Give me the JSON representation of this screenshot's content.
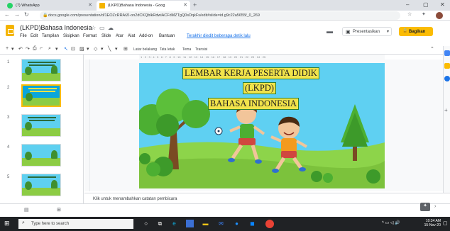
{
  "browser": {
    "tabs": [
      {
        "label": "(7) WhatsApp",
        "favicon_color": "#25d366"
      },
      {
        "label": "(LKPD)Bahasa Indonesia - Goog",
        "favicon_color": "#f4b400"
      }
    ],
    "new_tab": "+",
    "url": "docs.google.com/presentation/d/1EOZcRRAtZi-on2dCKQblkRdwiACFdMZTgQ0sDqkFs/edit#slide=id.g9c22a5655f_0_269",
    "window_buttons": {
      "minimize": "–",
      "maximize": "▢",
      "close": "✕"
    }
  },
  "docs": {
    "title": "(LKPD)Bahasa Indonesia",
    "menu": [
      "File",
      "Edit",
      "Tampilan",
      "Sisipkan",
      "Format",
      "Slide",
      "Atur",
      "Alat",
      "Add-on",
      "Bantuan"
    ],
    "last_edit": "Terakhir diedit beberapa detik lalu",
    "present_label": "Presentasikan",
    "share_label": "Bagikan"
  },
  "toolbar": {
    "background_label": "Latar belakang",
    "layout_label": "Tata letak",
    "theme_label": "Tema",
    "transition_label": "Transisi"
  },
  "ruler": {
    "numbers": "1 · 2 · 3 · 4 · 5 · 6 · 7 · 8 · 9 · 10 · 11 · 12 · 13 · 14 · 15 · 16 · 17 · 18 · 19 · 20 · 21 · 22 · 23 · 24 · 25"
  },
  "filmstrip": {
    "slides": [
      {
        "num": "1",
        "selected": false
      },
      {
        "num": "2",
        "selected": true
      },
      {
        "num": "3",
        "selected": false
      },
      {
        "num": "4",
        "selected": false
      },
      {
        "num": "5",
        "selected": false
      }
    ]
  },
  "slide": {
    "line1": "LEMBAR KERJA PESERTA DIDIK",
    "line2": "(LKPD)",
    "line3": "BAHASA INDONESIA"
  },
  "notes_placeholder": "Klik untuk menambahkan catatan pembicara",
  "taskbar": {
    "search_placeholder": "Type here to search",
    "time": "10:34 AM",
    "date": "15-Nov-20"
  }
}
